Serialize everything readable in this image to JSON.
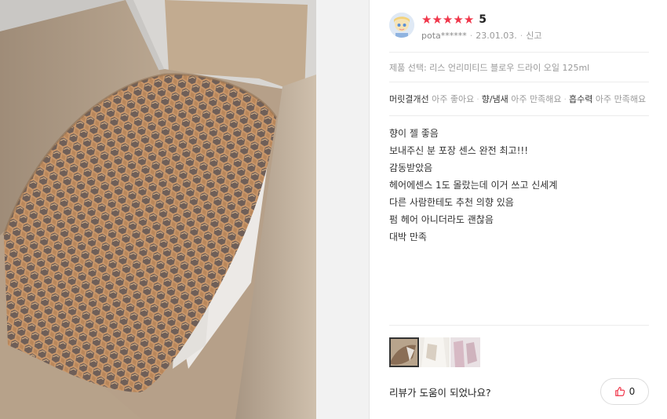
{
  "review": {
    "rating": 5,
    "stars": [
      "★",
      "★",
      "★",
      "★",
      "★"
    ],
    "score_label": "5",
    "user": "pota******",
    "date": "23.01.03.",
    "report_label": "신고",
    "product_option": "제품 선택: 리스 언리미티드 블로우 드라이 오일 125ml",
    "attributes": [
      {
        "name": "머릿결개선",
        "value": "아주 좋아요"
      },
      {
        "name": "향/냄새",
        "value": "아주 만족해요"
      },
      {
        "name": "흡수력",
        "value": "아주 만족해요"
      }
    ],
    "lines": [
      "향이 젤 좋음",
      "보내주신 분 포장 센스 완전 최고!!!",
      "감동받았음",
      "헤어에센스 1도 몰랐는데 이거 쓰고 신세계",
      "다른 사람한테도 추천 의향 있음",
      "펌 헤어 아니더라도 괜찮음",
      "대박 만족"
    ],
    "helpful_question": "리뷰가 도움이 되었나요?",
    "like_count": "0"
  },
  "colors": {
    "star": "#f0364a",
    "like_icon": "#f0364a",
    "muted": "#999999"
  },
  "icons": {
    "like": "thumbs-up-icon"
  }
}
